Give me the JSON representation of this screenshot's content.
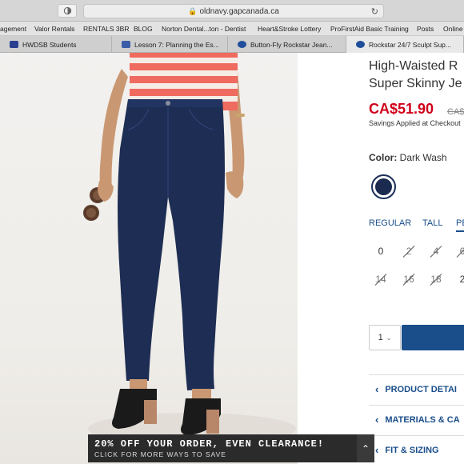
{
  "browser": {
    "url": "oldnavy.gapcanada.ca",
    "bookmarks": [
      "agement",
      "Valor Rentals",
      "RENTALS 3BR",
      "BLOG",
      "Norton Dental...ton - Dentist",
      "Heart&Stroke Lottery",
      "ProFirstAid Basic Training",
      "Posts",
      "Online"
    ],
    "tabs": [
      {
        "label": "HWDSB Students",
        "favicon_color": "#2a3f8f"
      },
      {
        "label": "Lesson 7: Planning the Es...",
        "favicon_color": "#3a5da8"
      },
      {
        "label": "Button-Fly Rockstar Jean...",
        "favicon_color": "#1f4f9a"
      },
      {
        "label": "Rockstar 24/7 Sculpt Sup...",
        "favicon_color": "#1f4f9a"
      }
    ]
  },
  "product": {
    "title_line1": "High-Waisted R",
    "title_line2": "Super Skinny Je",
    "price": "CA$51.90",
    "old_price": "CA$",
    "savings": "Savings Applied at Checkout",
    "color_label": "Color:",
    "color_value": "Dark Wash",
    "swatch_color": "#1b2a4f",
    "fit_tabs": [
      "REGULAR",
      "TALL",
      "PE"
    ],
    "sizes_row1": [
      {
        "label": "0",
        "available": true
      },
      {
        "label": "2",
        "available": false
      },
      {
        "label": "4",
        "available": false
      },
      {
        "label": "6",
        "available": false
      }
    ],
    "sizes_row2": [
      {
        "label": "14",
        "available": false
      },
      {
        "label": "16",
        "available": false
      },
      {
        "label": "18",
        "available": false
      },
      {
        "label": "2",
        "available": true
      }
    ],
    "quantity": "1",
    "add_button_color": "#1a4e8a",
    "accordions": [
      "PRODUCT DETAI",
      "MATERIALS & CA",
      "FIT & SIZING"
    ]
  },
  "promo": {
    "main": "20% OFF YOUR ORDER, EVEN CLEARANCE!",
    "sub": "CLICK FOR MORE WAYS TO SAVE"
  }
}
